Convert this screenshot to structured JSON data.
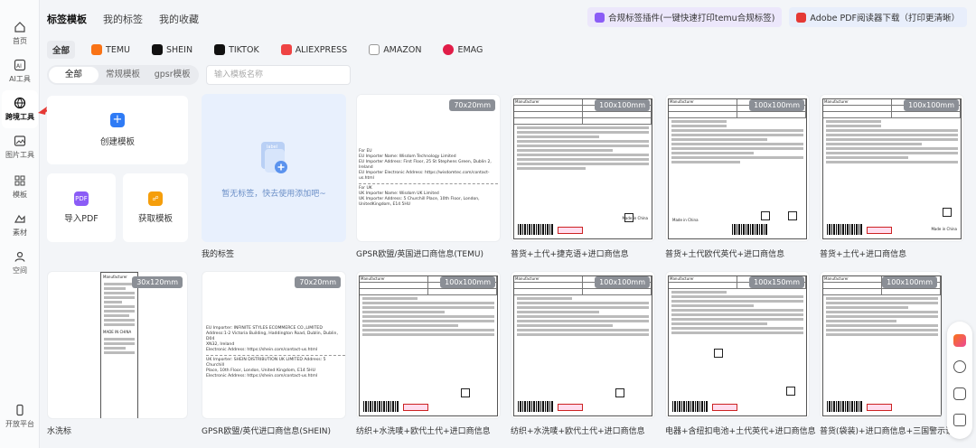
{
  "sidebar": {
    "items": [
      {
        "label": "首页",
        "icon": "home-icon"
      },
      {
        "label": "AI工具",
        "icon": "ai-icon"
      },
      {
        "label": "跨境工具",
        "icon": "globe-icon"
      },
      {
        "label": "图片工具",
        "icon": "image-icon"
      },
      {
        "label": "模板",
        "icon": "template-icon"
      },
      {
        "label": "素材",
        "icon": "material-icon"
      },
      {
        "label": "空间",
        "icon": "space-icon"
      },
      {
        "label": "开放平台",
        "icon": "phone-icon"
      }
    ]
  },
  "header": {
    "tabs": [
      "标签模板",
      "我的标签",
      "我的收藏"
    ],
    "plugin_button": "合规标签插件(一键快速打印temu合规标签)",
    "pdf_button": "Adobe PDF阅读器下载（打印更清晰）"
  },
  "platforms": [
    "全部",
    "TEMU",
    "SHEIN",
    "TIKTOK",
    "ALIEXPRESS",
    "AMAZON",
    "EMAG"
  ],
  "segment": [
    "全部",
    "常规模板",
    "gpsr模板"
  ],
  "search": {
    "placeholder": "输入模板名称"
  },
  "actions": {
    "create": "创建模板",
    "import_pdf": "导入PDF",
    "get_template": "获取模板",
    "pdf_icon_text": "PDF"
  },
  "my_labels": {
    "empty_text": "暂无标签，快去使用添加吧~",
    "caption": "我的标签",
    "label_icon_text": "label"
  },
  "templates": [
    {
      "size": "70x20mm",
      "caption": "GPSR欧盟/英国进口商信息(TEMU)"
    },
    {
      "size": "100x100mm",
      "caption": "普货+土代+捷克语+进口商信息"
    },
    {
      "size": "100x100mm",
      "caption": "普货+土代欧代英代+进口商信息"
    },
    {
      "size": "100x100mm",
      "caption": "普货+土代+进口商信息"
    },
    {
      "size": "30x120mm",
      "caption": "水洗标"
    },
    {
      "size": "70x20mm",
      "caption": "GPSR欧盟/英代进口商信息(SHEIN)"
    },
    {
      "size": "100x100mm",
      "caption": "纺织+水洗唛+欧代土代+进口商信息"
    },
    {
      "size": "100x100mm",
      "caption": "纺织+水洗唛+欧代土代+进口商信息"
    },
    {
      "size": "100x150mm",
      "caption": "电器+含纽扣电池+土代英代+进口商信息"
    },
    {
      "size": "100x100mm",
      "caption": "普货(袋装)+进口商信息+三国警示语"
    }
  ],
  "preview_text": {
    "temu_lines": [
      "For EU",
      "EU Importer Name: Wisdom Technology Limited",
      "EU Importer Address: First Floor, 25 St Stephens Green, Dublin 2, Ireland",
      "EU Importer Electronic Address: https://wisdomtec.com/contact-us.html",
      "For UK",
      "UK Importer Name: Wisdom UK Limited",
      "UK Importer Address: 5 Churchill Place, 10th Floor, London, UnitedKingdom, E14 5HU"
    ],
    "shein_lines": [
      "EU Importer: INFINITE STYLES ECOMMERCE CO.,LIMITED",
      "Address:1-2 Victoria Building, Haddington Road, Dublin, Dublin, D04",
      "XN32, Ireland",
      "Electronic Address: https://shein.com/contact-us.html",
      "UK Importer: SHEIN DISTRIBUTION UK LIMITED Address: 5 Churchill",
      "Place, 10th Floor, London, United Kingdom, E14 5HU",
      "Electronic Address: https://shein.com/contact-us.html"
    ],
    "manufacturer": "Manufacturer",
    "made_in_china": "Made in China",
    "made_in_china_caps": "MADE IN CHINA"
  },
  "colors": {
    "accent": "#2f7bf5",
    "empty_bg": "#e8f0fd",
    "pdf": "#8b5cf6",
    "share": "#f59e0b"
  }
}
